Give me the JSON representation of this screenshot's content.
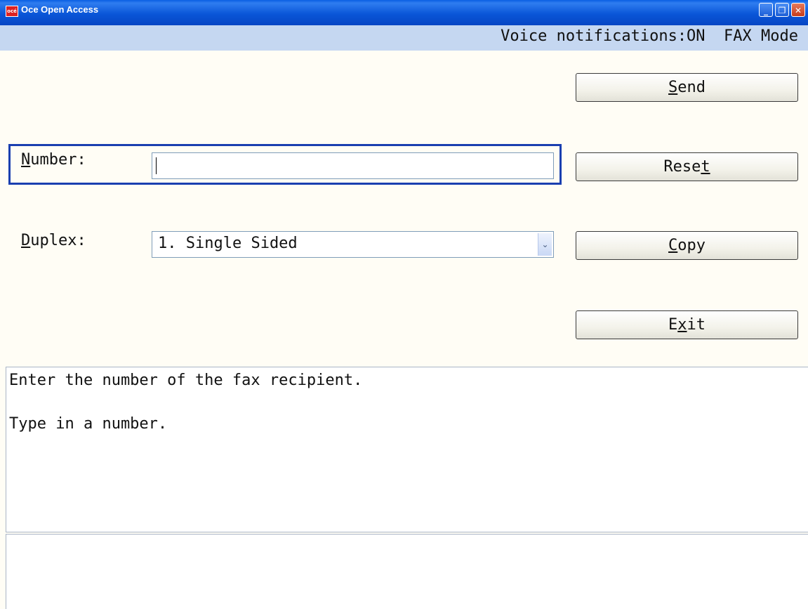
{
  "window": {
    "title": "Oce Open Access",
    "logo_text": "océ",
    "controls": {
      "minimize": "_",
      "restore": "❐",
      "close": "✕"
    }
  },
  "status": {
    "text": "Voice notifications:ON  FAX Mode"
  },
  "form": {
    "number": {
      "label_mnemonic": "N",
      "label_rest": "umber:",
      "value": ""
    },
    "duplex": {
      "label_mnemonic": "D",
      "label_rest": "uplex:",
      "selected": "1. Single Sided",
      "arrow": "⌄"
    }
  },
  "buttons": {
    "send": {
      "pre": "",
      "mnemonic": "S",
      "post": "end"
    },
    "reset": {
      "pre": "Rese",
      "mnemonic": "t",
      "post": ""
    },
    "copy": {
      "pre": "",
      "mnemonic": "C",
      "post": "opy"
    },
    "exit": {
      "pre": "E",
      "mnemonic": "x",
      "post": "it"
    }
  },
  "messages": {
    "line1": "Enter the number of the fax recipient.",
    "line2": "Type in a number."
  },
  "colors": {
    "titlebar": "#0a56d8",
    "statusbar": "#c5d7f1",
    "focus_border": "#1a3fb0",
    "background": "#fffdf5"
  }
}
